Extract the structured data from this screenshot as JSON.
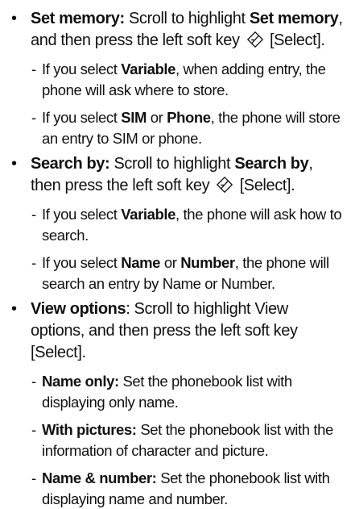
{
  "sections": [
    {
      "title": "Set memory:",
      "p1": "Scroll to highlight",
      "p1b": "Set memory",
      "p2": ", and then press the left soft key",
      "p3": "[Select].",
      "subs": [
        {
          "a": "If you select",
          "ab": "Variable",
          "b": ", when adding entry, the phone will ask where to store."
        },
        {
          "a": "If you select",
          "ab": "SIM",
          "mid": "or",
          "bb": "Phone",
          "b": ", the phone will store an entry to SIM or phone."
        }
      ]
    },
    {
      "title": "Search by:",
      "p1": "Scroll to highlight",
      "p1b": "Search by",
      "p2": ", then press the left soft key",
      "p3": "[Select].",
      "subs": [
        {
          "a": "If you select",
          "ab": "Variable",
          "b": ", the phone will ask how to search."
        },
        {
          "a": "If you select",
          "ab": "Name",
          "mid": "or",
          "bb": "Number",
          "b": ", the phone will search an entry by Name or Number."
        }
      ]
    },
    {
      "title": "View options",
      "p1": ": Scroll to highlight View options, and then press the left soft key [Select].",
      "subs": [
        {
          "label": "Name only:",
          "text": "Set the phonebook list with displaying only name."
        },
        {
          "label": "With pictures:",
          "text": "Set the phonebook list with the information of character and picture."
        },
        {
          "label": "Name & number:",
          "text": "Set the phonebook list with displaying name and number."
        }
      ]
    }
  ],
  "bullet_char": "•",
  "dash_char": "-",
  "softkey_icon": "left-soft-key-icon"
}
